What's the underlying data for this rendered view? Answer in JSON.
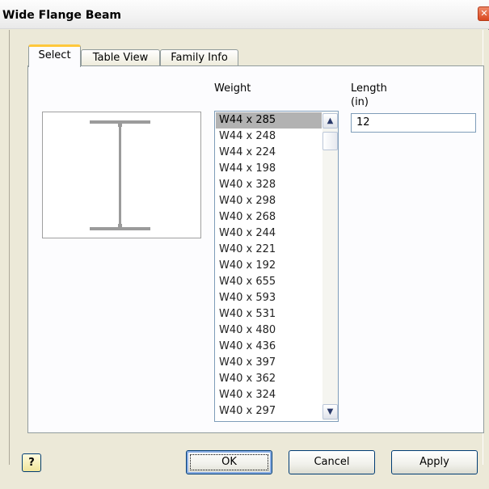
{
  "window": {
    "title": "Wide Flange Beam",
    "close_glyph": "✕"
  },
  "tabs": [
    {
      "label": "Select",
      "active": true
    },
    {
      "label": "Table View",
      "active": false
    },
    {
      "label": "Family Info",
      "active": false
    }
  ],
  "preview": {
    "icon": "i-beam-icon",
    "colors": {
      "beam": "#9b9b9b",
      "background": "#ffffff"
    }
  },
  "weight": {
    "label": "Weight",
    "selected": "W44 x 285",
    "items": [
      "W44 x 285",
      "W44 x 248",
      "W44 x 224",
      "W44 x 198",
      "W40 x 328",
      "W40 x 298",
      "W40 x 268",
      "W40 x 244",
      "W40 x 221",
      "W40 x 192",
      "W40 x 655",
      "W40 x 593",
      "W40 x 531",
      "W40 x 480",
      "W40 x 436",
      "W40 x 397",
      "W40 x 362",
      "W40 x 324",
      "W40 x 297"
    ],
    "scroll_up_glyph": "▲",
    "scroll_down_glyph": "▼"
  },
  "length": {
    "label_line1": "Length",
    "label_line2": "(in)",
    "value": "12"
  },
  "buttons": {
    "help_glyph": "?",
    "ok": "OK",
    "cancel": "Cancel",
    "apply": "Apply"
  },
  "colors": {
    "dialog_bg": "#ece9d8",
    "tab_accent": "#ffc83c",
    "selection": "#b2b2b2",
    "close_button": "#d9481f"
  }
}
